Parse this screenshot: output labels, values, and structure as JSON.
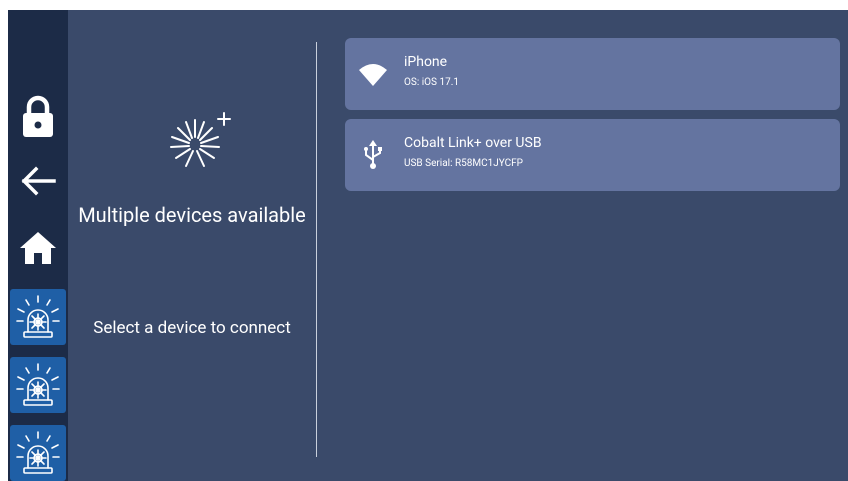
{
  "sidebar": {
    "buttons": [
      {
        "name": "lock",
        "icon": "lock-icon"
      },
      {
        "name": "back",
        "icon": "arrow-left-icon"
      },
      {
        "name": "home",
        "icon": "home-icon"
      },
      {
        "name": "alarm-1",
        "icon": "beacon-icon"
      },
      {
        "name": "alarm-2",
        "icon": "beacon-icon"
      },
      {
        "name": "alarm-3",
        "icon": "beacon-icon"
      }
    ]
  },
  "status": {
    "icon": "searching-icon",
    "title": "Multiple devices available",
    "instruction": "Select a device to connect"
  },
  "devices": [
    {
      "name": "iPhone",
      "detail": "OS: iOS 17.1",
      "icon": "wifi-icon"
    },
    {
      "name": "Cobalt Link+ over USB",
      "detail": "USB Serial: R58MC1JYCFP",
      "icon": "usb-icon"
    }
  ],
  "colors": {
    "background": "#3a4a6a",
    "sidebar": "#1c2b47",
    "alarm_button": "#1f5fa6",
    "device_card": "#6474a0"
  }
}
